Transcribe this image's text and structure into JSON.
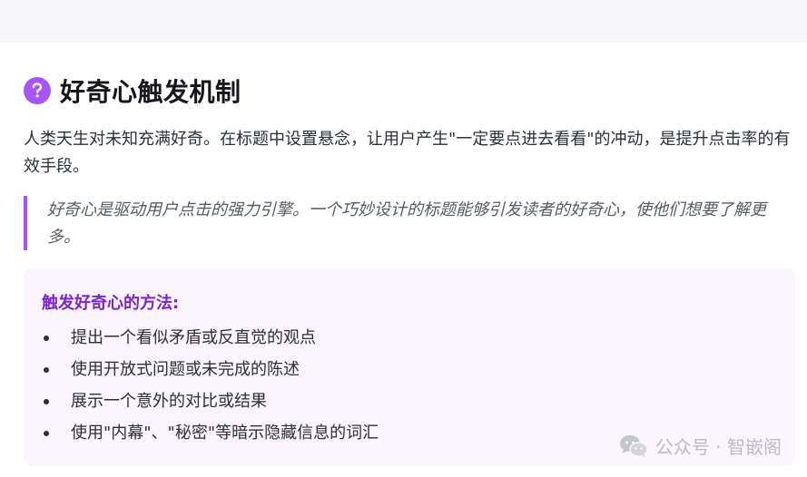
{
  "section": {
    "heading": "好奇心触发机制",
    "intro": "人类天生对未知充满好奇。在标题中设置悬念，让用户产生\"一定要点进去看看\"的冲动，是提升点击率的有效手段。",
    "quote": "好奇心是驱动用户点击的强力引擎。一个巧妙设计的标题能够引发读者的好奇心，使他们想要了解更多。"
  },
  "tips": {
    "title": "触发好奇心的方法:",
    "items": [
      "提出一个看似矛盾或反直觉的观点",
      "使用开放式问题或未完成的陈述",
      "展示一个意外的对比或结果",
      "使用\"内幕\"、\"秘密\"等暗示隐藏信息的词汇"
    ]
  },
  "watermark": {
    "text": "公众号 · 智嵌阁",
    "icon": "wechat-icon"
  },
  "colors": {
    "accent": "#a855f7",
    "tips_title": "#7e22ce",
    "tips_bg": "#faf5ff"
  }
}
